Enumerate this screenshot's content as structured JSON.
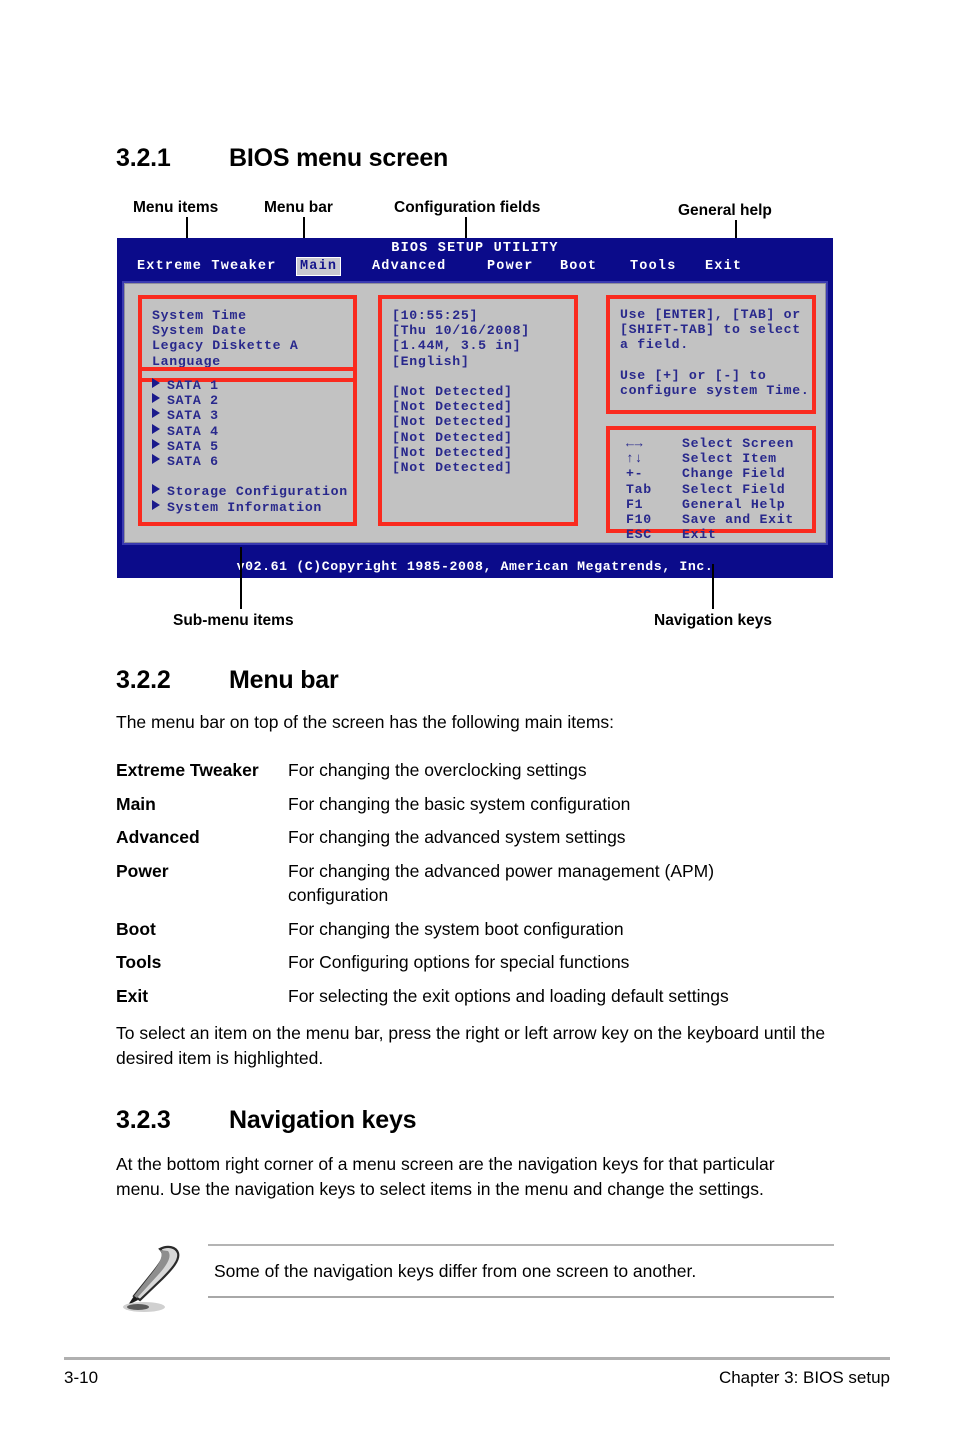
{
  "sections": {
    "s321": {
      "num": "3.2.1",
      "title": "BIOS menu screen"
    },
    "s322": {
      "num": "3.2.2",
      "title": "Menu bar"
    },
    "s323": {
      "num": "3.2.3",
      "title": "Navigation keys"
    }
  },
  "callouts": {
    "menu_items": "Menu items",
    "menu_bar": "Menu bar",
    "config_fields": "Configuration fields",
    "general_help": "General help",
    "submenu_items": "Sub-menu items",
    "navigation_keys": "Navigation keys"
  },
  "bios": {
    "title": "BIOS SETUP UTILITY",
    "tabs": [
      {
        "label": "Extreme Tweaker",
        "active": false
      },
      {
        "label": "Main",
        "active": true
      },
      {
        "label": "Advanced",
        "active": false
      },
      {
        "label": "Power",
        "active": false
      },
      {
        "label": "Boot",
        "active": false
      },
      {
        "label": "Tools",
        "active": false
      },
      {
        "label": "Exit",
        "active": false
      }
    ],
    "menu_items": [
      "System Time",
      "System Date",
      "Legacy Diskette A",
      "Language"
    ],
    "submenu_items": [
      "SATA 1",
      "SATA 2",
      "SATA 3",
      "SATA 4",
      "SATA 5",
      "SATA 6"
    ],
    "submenu_items2": [
      "Storage Configuration",
      "System Information"
    ],
    "config_fields": [
      "[10:55:25]",
      "[Thu 10/16/2008]",
      "[1.44M, 3.5 in]",
      "[English]"
    ],
    "config_fields2": [
      "[Not Detected]",
      "[Not Detected]",
      "[Not Detected]",
      "[Not Detected]",
      "[Not Detected]",
      "[Not Detected]"
    ],
    "help_lines": [
      "Use [ENTER], [TAB] or",
      "[SHIFT-TAB] to select",
      "a field.",
      "",
      "Use [+] or [-] to",
      "configure system Time."
    ],
    "nav_keys": [
      {
        "key": "←→",
        "desc": "Select Screen"
      },
      {
        "key": "↑↓",
        "desc": "Select Item"
      },
      {
        "key": "+-",
        "desc": "Change Field"
      },
      {
        "key": "Tab",
        "desc": "Select Field"
      },
      {
        "key": "F1",
        "desc": "General Help"
      },
      {
        "key": "F10",
        "desc": "Save and Exit"
      },
      {
        "key": "ESC",
        "desc": "Exit"
      }
    ],
    "footer": "v02.61 (C)Copyright 1985-2008, American Megatrends, Inc.",
    "colors": {
      "chrome": "#0b0b8a",
      "panel": "#c2c2c2",
      "text": "#28288c",
      "annotation": "#fa2a1e"
    }
  },
  "menu_bar_section": {
    "intro": "The menu bar on top of the screen has the following main items:",
    "rows": [
      {
        "term": "Extreme Tweaker",
        "desc": "For changing the overclocking settings"
      },
      {
        "term": "Main",
        "desc": "For changing the basic system configuration"
      },
      {
        "term": "Advanced",
        "desc": "For changing the advanced system settings"
      },
      {
        "term": "Power",
        "desc": "For changing the advanced power management (APM) configuration"
      },
      {
        "term": "Boot",
        "desc": "For changing the system boot configuration"
      },
      {
        "term": "Tools",
        "desc": "For Configuring options for special functions"
      },
      {
        "term": "Exit",
        "desc": "For selecting the exit options and loading default settings"
      }
    ],
    "outro": "To select an item on the menu bar, press the right or left arrow key on the keyboard until the desired item is highlighted."
  },
  "nav_keys_section": {
    "paragraph": "At the bottom right corner of a menu screen are the navigation keys for that particular menu. Use the navigation keys to select items in the menu and change the settings."
  },
  "note": {
    "text": "Some of the navigation keys differ from one screen to another."
  },
  "footer": {
    "page": "3-10",
    "chapter": "Chapter 3: BIOS setup"
  }
}
